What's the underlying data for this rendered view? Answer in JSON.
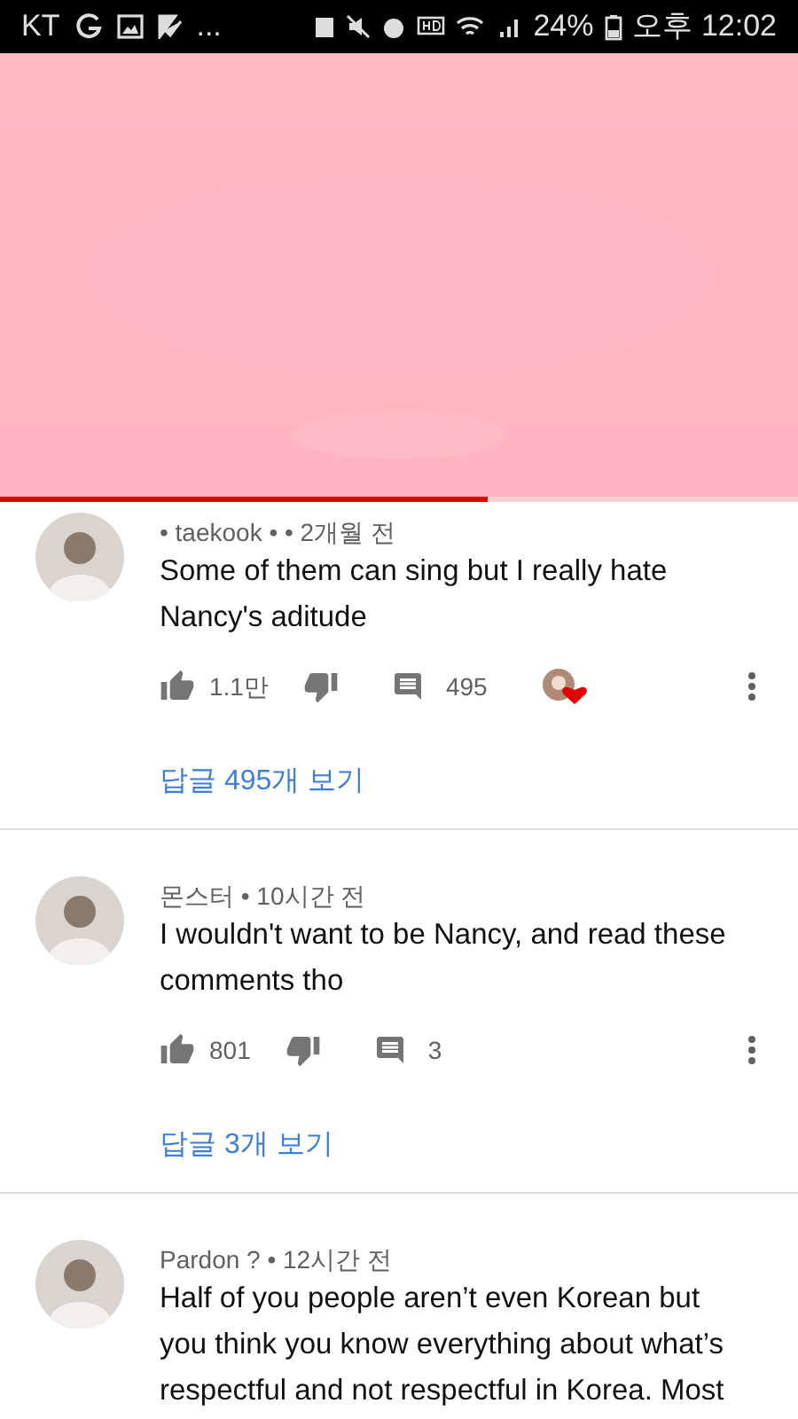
{
  "status_bar": {
    "carrier": "KT",
    "more": "...",
    "battery": "24%",
    "time": "오후 12:02"
  },
  "video": {
    "progress": {
      "level": 0.61
    }
  },
  "comments": [
    {
      "author": "• taekook • • 2개월 전",
      "text": "Some of them can sing but I really hate Nancy's aditude",
      "actions": {
        "likes": "1.1만",
        "replies": "495",
        "hearted": true
      },
      "view_replies": "답글 495개 보기"
    },
    {
      "author": "몬스터 • 10시간 전",
      "text": "I wouldn't want to be Nancy, and read these comments tho",
      "actions": {
        "likes": "801",
        "replies": "3",
        "hearted": false
      },
      "view_replies": "답글 3개 보기"
    },
    {
      "author": "Pardon ? • 12시간 전",
      "text": "Half of you people aren’t even Korean but you think you know everything about what’s respectful and not respectful in Korea. Most"
    }
  ]
}
